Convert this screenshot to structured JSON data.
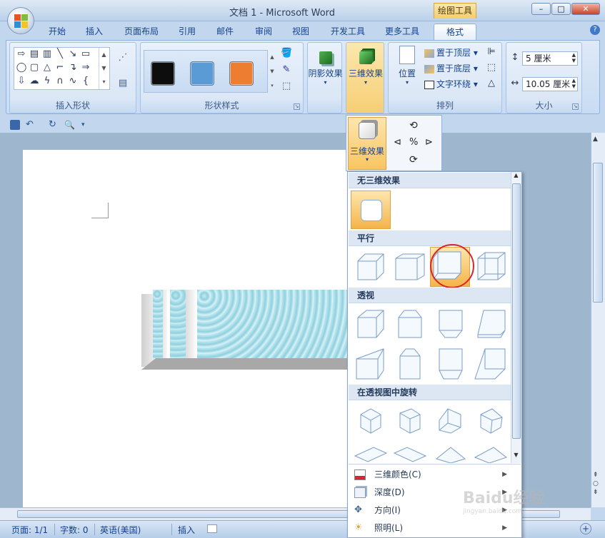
{
  "window": {
    "title": "文档 1 - Microsoft Word",
    "context_tab_group": "绘图工具",
    "controls": {
      "minimize": "–",
      "maximize": "□",
      "close": "✕"
    }
  },
  "ribbon_tabs": [
    "开始",
    "插入",
    "页面布局",
    "引用",
    "邮件",
    "审阅",
    "视图",
    "开发工具",
    "更多工具",
    "格式"
  ],
  "active_tab": "格式",
  "help_icon": "?",
  "groups": {
    "insert_shapes": {
      "label": "插入形状"
    },
    "shape_styles": {
      "label": "形状样式",
      "swatches": [
        "#0d0d0d",
        "#5b9bd5",
        "#ed7d31"
      ]
    },
    "shadow_effects": {
      "label": "阴影效果"
    },
    "threed_effects": {
      "label": "三维效果"
    },
    "arrange": {
      "label": "排列",
      "position": "位置",
      "bring_front": "置于顶层",
      "send_back": "置于底层",
      "text_wrap": "文字环绕"
    },
    "size": {
      "label": "大小",
      "height": "5 厘米",
      "width": "10.05 厘米"
    }
  },
  "threed_popup": {
    "button_label": "三维效果",
    "sections": {
      "none": "无三维效果",
      "parallel": "平行",
      "perspective": "透视",
      "rotate": "在透视图中旋转"
    },
    "menu_items": [
      "三维颜色(C)",
      "深度(D)",
      "方向(I)",
      "照明(L)"
    ]
  },
  "status": {
    "page": "页面: 1/1",
    "words": "字数: 0",
    "language": "英语(美国)",
    "mode": "插入"
  },
  "watermark": {
    "brand": "Baidu经验",
    "url": "jingyan.baidu.com"
  },
  "colors": {
    "ribbon_blue": "#c2d7ee",
    "selection_orange": "#f8c469",
    "highlight_circle": "#d9262b"
  }
}
